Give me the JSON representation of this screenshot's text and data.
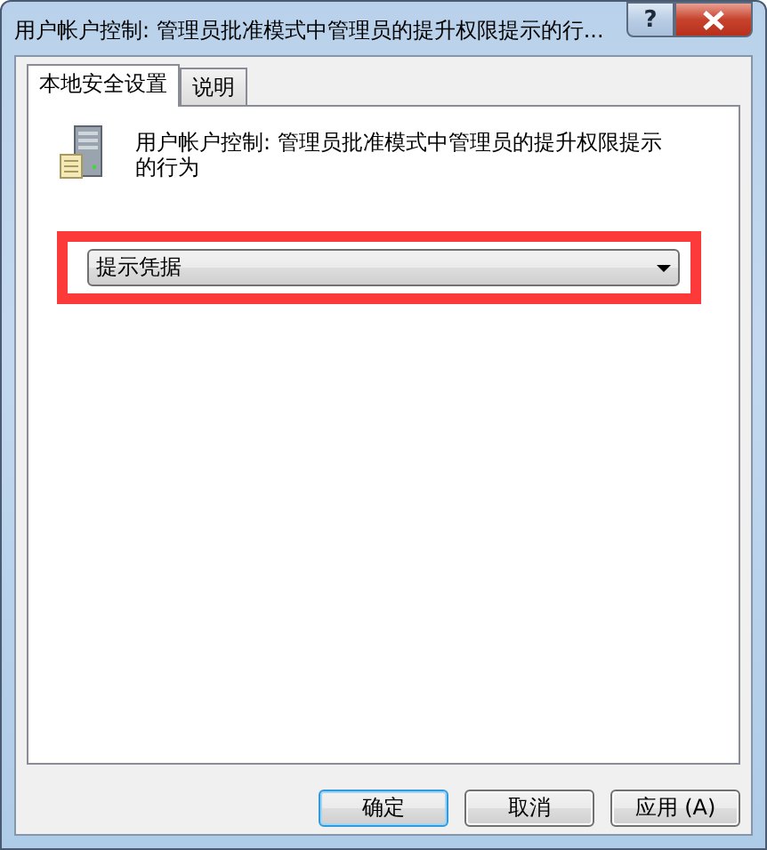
{
  "window": {
    "title": "用户帐户控制: 管理员批准模式中管理员的提升权限提示的行...",
    "help": "?"
  },
  "tabs": [
    {
      "label": "本地安全设置",
      "selected": true
    },
    {
      "label": "说明",
      "selected": false
    }
  ],
  "policy": {
    "text": "用户帐户控制: 管理员批准模式中管理员的提升权限提示的行为"
  },
  "dropdown": {
    "value": "提示凭据"
  },
  "buttons": [
    {
      "label": "确定",
      "default": true
    },
    {
      "label": "取消",
      "default": false
    },
    {
      "label": "应用 (A)",
      "default": false
    }
  ]
}
